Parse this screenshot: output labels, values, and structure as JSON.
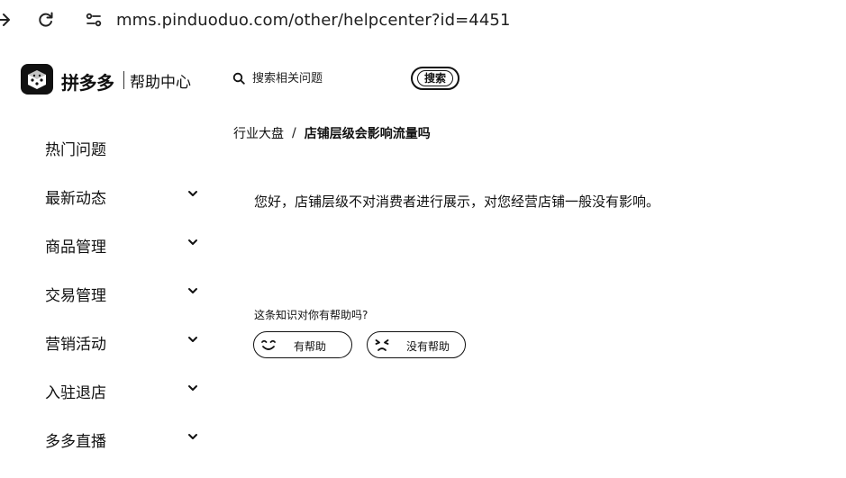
{
  "browser": {
    "url": "mms.pinduoduo.com/other/helpcenter?id=4451",
    "icons": [
      "arrow-right-icon",
      "reload-icon",
      "site-settings-icon"
    ]
  },
  "header": {
    "brand": "拼多多",
    "subtitle": "帮助中心",
    "search_placeholder": "搜索相关问题",
    "search_button": "搜索"
  },
  "sidebar": {
    "items": [
      {
        "label": "热门问题",
        "expandable": false
      },
      {
        "label": "最新动态",
        "expandable": true
      },
      {
        "label": "商品管理",
        "expandable": true
      },
      {
        "label": "交易管理",
        "expandable": true
      },
      {
        "label": "营销活动",
        "expandable": true
      },
      {
        "label": "入驻退店",
        "expandable": true
      },
      {
        "label": "多多直播",
        "expandable": true
      }
    ]
  },
  "breadcrumb": {
    "parent": "行业大盘",
    "separator": "/",
    "current": "店铺层级会影响流量吗"
  },
  "article": {
    "answer": "您好，店铺层级不对消费者进行展示，对您经营店铺一般没有影响。"
  },
  "feedback": {
    "question": "这条知识对你有帮助吗?",
    "helpful": "有帮助",
    "not_helpful": "没有帮助"
  }
}
